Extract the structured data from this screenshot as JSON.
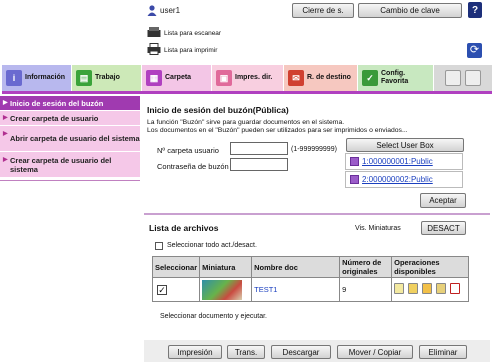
{
  "header": {
    "user": "user1",
    "logout_label": "Cierre de s.",
    "change_password_label": "Cambio de clave",
    "help_label": "?",
    "status_scan": "Lista para escanear",
    "status_print": "Lista para imprimir"
  },
  "tabs": [
    {
      "label": "Información",
      "color": "#6a6ad0"
    },
    {
      "label": "Trabajo",
      "color": "#3aa33a"
    },
    {
      "label": "Carpeta",
      "color": "#b040c0"
    },
    {
      "label": "Impres. dir.",
      "color": "#e06a9a"
    },
    {
      "label": "R. de destino",
      "color": "#d04030"
    },
    {
      "label": "Config. Favorita",
      "color": "#3a9a3a"
    }
  ],
  "sidebar": {
    "items": [
      {
        "label": "Inicio de sesión del buzón"
      },
      {
        "label": "Crear carpeta de usuario"
      },
      {
        "label": "Abrir carpeta de usuario del sistema"
      },
      {
        "label": "Crear carpeta de usuario del sistema"
      }
    ]
  },
  "login": {
    "title": "Inicio de sesión del buzón(Pública)",
    "description_1": "La función \"Buzón\" sirve para guardar documentos en el sistema.",
    "description_2": "Los documentos en el \"Buzón\" pueden ser utilizados para ser imprimidos o enviados...",
    "folder_label": "Nº carpeta usuario",
    "folder_range": "(1-999999999)",
    "password_label": "Contraseña de buzón",
    "select_box_label": "Select User Box",
    "boxes": [
      "1:000000001:Public",
      "2:000000002:Public"
    ],
    "accept_label": "Aceptar"
  },
  "files": {
    "title": "Lista de archivos",
    "view_label": "Vis. Miniaturas",
    "view_toggle": "DESACT",
    "select_all_label": "Seleccionar todo act./desact.",
    "columns": [
      "Seleccionar",
      "Miniatura",
      "Nombre doc",
      "Número de originales",
      "Operaciones disponibles"
    ],
    "rows": [
      {
        "name": "TEST1",
        "originals": "9"
      }
    ],
    "hint": "Seleccionar documento y ejecutar."
  },
  "actions": {
    "print": "Impresión",
    "trans": "Trans.",
    "download": "Descargar",
    "move_copy": "Mover / Copiar",
    "delete": "Eliminar"
  }
}
